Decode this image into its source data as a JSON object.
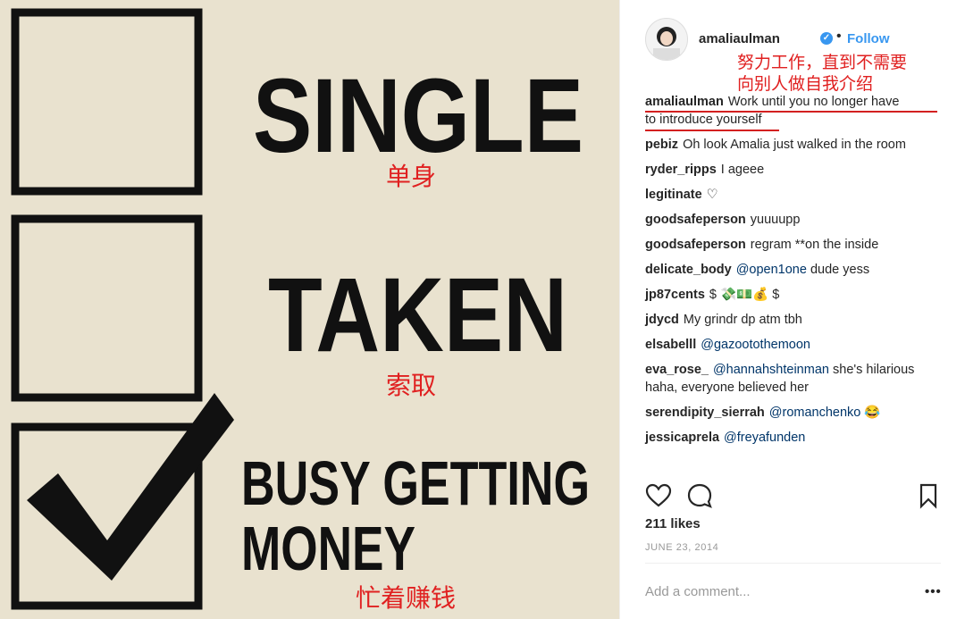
{
  "image": {
    "title_single": "SINGLE",
    "title_taken": "TAKEN",
    "title_busy_line1": "BUSY GETTING",
    "title_busy_line2": "MONEY",
    "cn_single": "单身",
    "cn_taken": "索取",
    "cn_busy": "忙着赚钱"
  },
  "header": {
    "username": "amaliaulman",
    "follow": "Follow",
    "cn_line1": "努力工作，直到不需要",
    "cn_line2": "向别人做自我介绍"
  },
  "caption": {
    "username": "amaliaulman",
    "text_line1": "Work until you no longer have",
    "text_line2": "to introduce yourself"
  },
  "comments": [
    {
      "user": "pebiz",
      "text": "Oh look Amalia just walked in the room"
    },
    {
      "user": "ryder_ripps",
      "text": "I ageee"
    },
    {
      "user": "legitinate",
      "text": "♡"
    },
    {
      "user": "goodsafeperson",
      "text": "yuuuupp"
    },
    {
      "user": "goodsafeperson",
      "text": "regram **on the inside"
    },
    {
      "user": "delicate_body",
      "mention": "@open1one",
      "text": "dude yess"
    },
    {
      "user": "jp87cents",
      "text": "$ 💸💵💰 $"
    },
    {
      "user": "jdycd",
      "text": "My grindr dp atm tbh"
    },
    {
      "user": "elsabelll",
      "mention": "@gazootothemoon",
      "text": ""
    },
    {
      "user": "eva_rose_",
      "mention": "@hannahshteinman",
      "text": "she's hilarious haha, everyone believed her"
    },
    {
      "user": "serendipity_sierrah",
      "mention": "@romanchenko",
      "text": "😂"
    },
    {
      "user": "jessicaprela",
      "mention": "@freyafunden",
      "text": ""
    }
  ],
  "likes": "211 likes",
  "date": "JUNE 23, 2014",
  "add_comment_placeholder": "Add a comment...",
  "more_label": "•••",
  "icons": [
    "heart-icon",
    "comment-icon",
    "bookmark-icon",
    "verified-icon"
  ],
  "colors": {
    "accent": "#3897f0",
    "annotation_red": "#e02020",
    "image_bg": "#e9e2cf"
  }
}
